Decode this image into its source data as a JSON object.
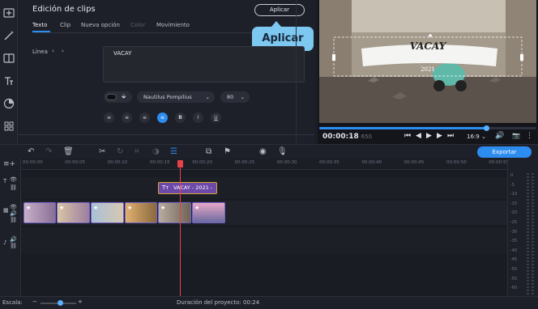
{
  "editor": {
    "title": "Edición de clips",
    "apply_label": "Aplicar",
    "callout_label": "Aplicar",
    "tabs": [
      {
        "label": "Texto"
      },
      {
        "label": "Clip"
      },
      {
        "label": "Nueva opción"
      },
      {
        "label": "Color"
      },
      {
        "label": "Movimiento"
      }
    ],
    "line_label": "Línea",
    "text_value": "VACAY",
    "font_name": "Nautilus Pompilius",
    "font_size": "80",
    "format_buttons": [
      "align-left-icon",
      "align-right-icon",
      "align-justify-icon",
      "align-center-icon",
      "bold-icon",
      "italic-icon",
      "underline-icon"
    ]
  },
  "preview": {
    "video_title": "VACAY",
    "video_subtitle": "2021",
    "time_current": "00:00:18",
    "time_frames": "650",
    "aspect_ratio": "16:9",
    "progress": 0.77
  },
  "timeline": {
    "export_label": "Exportar",
    "ruler_ticks": [
      "00:00:00",
      "00:00:05",
      "00:00:10",
      "00:00:15",
      "00:00:20",
      "00:00:25",
      "00:00:30",
      "00:00:35",
      "00:00:40",
      "00:00:45",
      "00:00:50",
      "00:00:55"
    ],
    "title_clip_label": "VACAY - 2021 -",
    "meter_labels": [
      "0",
      "-5",
      "-10",
      "-15",
      "-20",
      "-25",
      "-30",
      "-35",
      "-40",
      "-45",
      "-50",
      "-55",
      "-60"
    ]
  },
  "status": {
    "scale_label": "Escala:",
    "duration_label": "Duración del proyecto:",
    "duration_value": "00:24"
  },
  "colors": {
    "accent": "#2d8cf0",
    "callout": "#7cc8f0",
    "title_clip": "#6c48a8",
    "playhead": "#e8414a"
  }
}
